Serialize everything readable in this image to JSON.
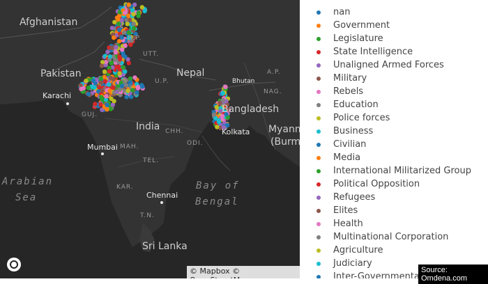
{
  "map": {
    "labels": {
      "countries": [
        "Afghanistan",
        "Pakistan",
        "Nepal",
        "India",
        "Bangladesh",
        "Myanm",
        "(Burm",
        "Bhutan",
        "Sri Lanka"
      ],
      "states": [
        "H.P.",
        "UTT.",
        "U.P.",
        "GUJ.",
        "CHH.",
        "MAH.",
        "ODI.",
        "TEL.",
        "KAR.",
        "T.N.",
        "A.P.",
        "NAG."
      ],
      "cities": [
        "Karachi",
        "Mumbai",
        "Chennai",
        "Kolkata"
      ],
      "seas": [
        "Arabian",
        "Sea",
        "Bay of",
        "Bengal"
      ]
    },
    "attribution": "© Mapbox © OpenStreetMap",
    "logo": "mapbox-logo-icon"
  },
  "legend": {
    "items": [
      {
        "label": "nan",
        "color": "#1f77b4"
      },
      {
        "label": "Government",
        "color": "#ff7f0e"
      },
      {
        "label": "Legislature",
        "color": "#2ca02c"
      },
      {
        "label": "State Intelligence",
        "color": "#d62728"
      },
      {
        "label": "Unaligned Armed Forces",
        "color": "#9467bd"
      },
      {
        "label": "Military",
        "color": "#8c564b"
      },
      {
        "label": "Rebels",
        "color": "#e377c2"
      },
      {
        "label": "Education",
        "color": "#7f7f7f"
      },
      {
        "label": "Police forces",
        "color": "#bcbd22"
      },
      {
        "label": "Business",
        "color": "#17becf"
      },
      {
        "label": "Civilian",
        "color": "#1f77b4"
      },
      {
        "label": "Media",
        "color": "#ff7f0e"
      },
      {
        "label": "International Militarized Group",
        "color": "#2ca02c"
      },
      {
        "label": "Political Opposition",
        "color": "#d62728"
      },
      {
        "label": "Refugees",
        "color": "#9467bd"
      },
      {
        "label": "Elites",
        "color": "#8c564b"
      },
      {
        "label": "Health",
        "color": "#e377c2"
      },
      {
        "label": "Multinational Corporation",
        "color": "#7f7f7f"
      },
      {
        "label": "Agriculture",
        "color": "#bcbd22"
      },
      {
        "label": "Judiciary",
        "color": "#17becf"
      },
      {
        "label": "Inter-Governmental Organisation",
        "color": "#1f77b4"
      }
    ]
  },
  "source": "Source: Omdena.com"
}
